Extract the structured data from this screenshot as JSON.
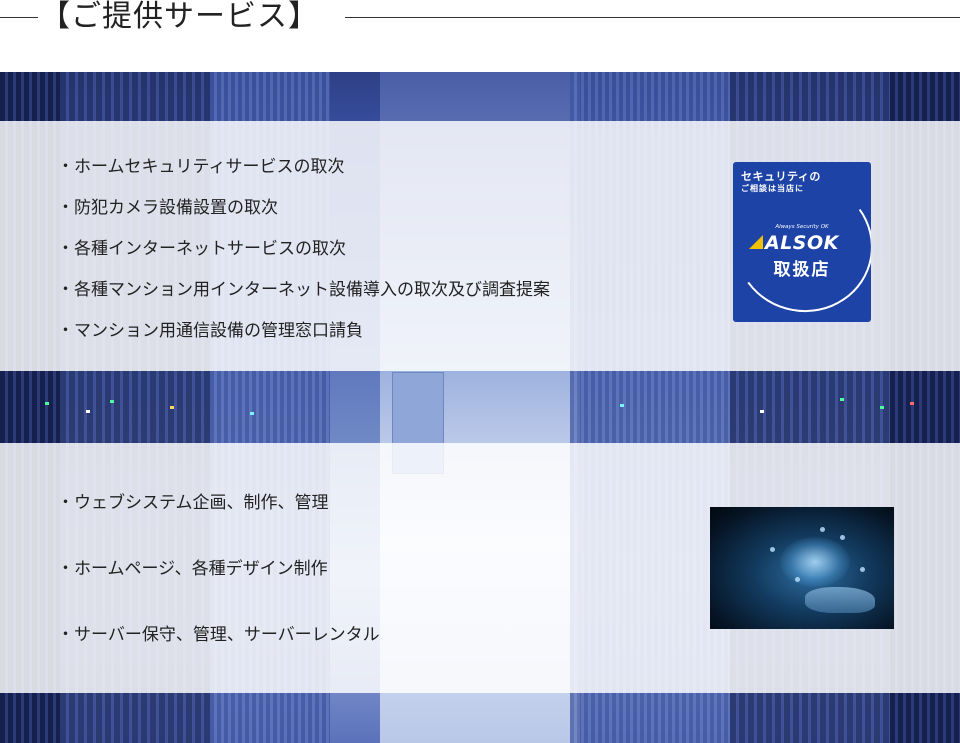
{
  "header": {
    "title": "【ご提供サービス】"
  },
  "security_services": {
    "items": [
      "・ホームセキュリティサービスの取次",
      "・防犯カメラ設備設置の取次",
      "・各種インターネットサービスの取次",
      "・各種マンション用インターネット設備導入の取次及び調査提案",
      "・マンション用通信設備の管理窓口請負"
    ],
    "badge": {
      "line1": "セキュリティの",
      "line2": "ご相談は当店に",
      "tagline": "Always Security OK",
      "brand": "ALSOK",
      "dealer": "取扱店",
      "color": "#1d43a6",
      "accent": "#f0c100"
    }
  },
  "web_services": {
    "items": [
      "・ウェブシステム企画、制作、管理",
      "・ホームページ、各種デザイン制作",
      "・サーバー保守、管理、サーバーレンタル"
    ]
  },
  "colors": {
    "background": "#3b54a7",
    "panel": "#ffffff",
    "text": "#222222"
  }
}
